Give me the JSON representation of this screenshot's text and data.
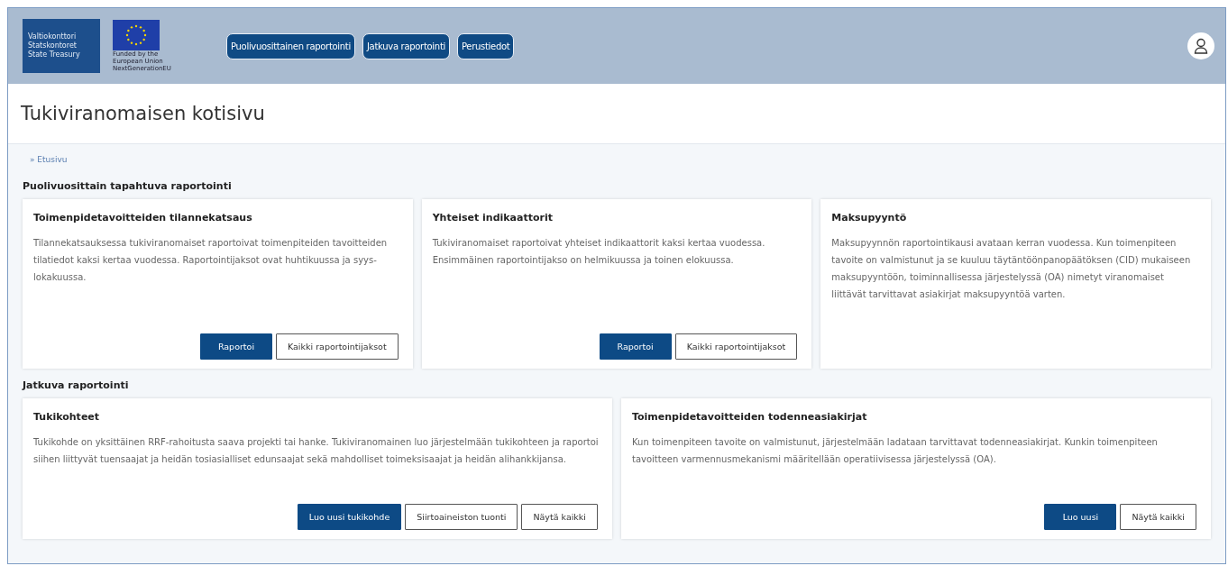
{
  "header": {
    "logo_lines": [
      "Valtiokonttori",
      "Statskontoret",
      "State Treasury"
    ],
    "eu_logo_lines": [
      "Funded by the",
      "European Union",
      "NextGenerationEU"
    ],
    "nav": [
      "Puolivuosittainen raportointi",
      "Jatkuva raportointi",
      "Perustiedot"
    ]
  },
  "page_title": "Tukiviranomaisen kotisivu",
  "breadcrumb": "» Etusivu",
  "sections": [
    {
      "title": "Puolivuosittain tapahtuva raportointi",
      "cards": [
        {
          "title": "Toimenpidetavoitteiden tilannekatsaus",
          "text": "Tilannekatsauksessa tukiviranomaiset raportoivat toimenpiteiden tavoitteiden tilatiedot kaksi kertaa vuodessa. Raportointijaksot ovat huhtikuussa ja syys-lokakuussa.",
          "buttons": [
            {
              "label": "Raportoi",
              "kind": "primary"
            },
            {
              "label": "Kaikki raportointijaksot",
              "kind": "secondary"
            }
          ]
        },
        {
          "title": "Yhteiset indikaattorit",
          "text": "Tukiviranomaiset raportoivat yhteiset indikaattorit kaksi kertaa vuodessa. Ensimmäinen raportointijakso on helmikuussa ja toinen elokuussa.",
          "buttons": [
            {
              "label": "Raportoi",
              "kind": "primary"
            },
            {
              "label": "Kaikki raportointijaksot",
              "kind": "secondary"
            }
          ]
        },
        {
          "title": "Maksupyyntö",
          "text": "Maksupyynnön raportointikausi avataan kerran vuodessa. Kun toimenpiteen tavoite on valmistunut ja se kuuluu täytäntöönpanopäätöksen (CID) mukaiseen maksupyyntöön, toiminnallisessa järjestelyssä (OA) nimetyt viranomaiset liittävät tarvittavat asiakirjat maksupyyntöä varten."
        }
      ]
    },
    {
      "title": "Jatkuva raportointi",
      "cards": [
        {
          "title": "Tukikohteet",
          "text": "Tukikohde on yksittäinen RRF-rahoitusta saava projekti tai hanke. Tukiviranomainen luo järjestelmään tukikohteen ja raportoi siihen liittyvät tuensaajat ja heidän tosiasialliset edunsaajat sekä mahdolliset toimeksisaajat ja heidän alihankkijansa.",
          "buttons": [
            {
              "label": "Luo uusi tukikohde",
              "kind": "primary"
            },
            {
              "label": "Siirtoaineiston tuonti",
              "kind": "secondary"
            },
            {
              "label": "Näytä kaikki",
              "kind": "secondary"
            }
          ]
        },
        {
          "title": "Toimenpidetavoitteiden todenneasiakirjat",
          "text": "Kun toimenpiteen tavoite on valmistunut, järjestelmään ladataan tarvittavat todenneasiakirjat. Kunkin toimenpiteen tavoitteen varmennusmekanismi määritellään operatiivisessa järjestelyssä (OA).",
          "buttons": [
            {
              "label": "Luo uusi",
              "kind": "primary"
            },
            {
              "label": "Näytä kaikki",
              "kind": "secondary"
            }
          ]
        }
      ]
    }
  ]
}
